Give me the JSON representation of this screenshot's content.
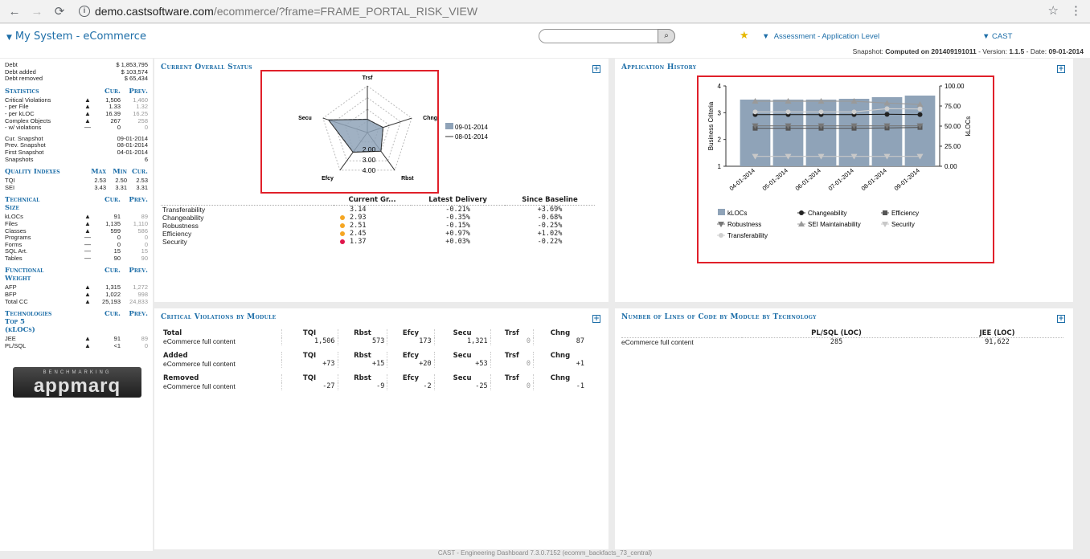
{
  "browser": {
    "url_host": "demo.castsoftware.com",
    "url_path": "/ecommerce/?frame=FRAME_PORTAL_RISK_VIEW"
  },
  "header": {
    "title": "My System - eCommerce",
    "assessment": "Assessment - Application Level",
    "user": "CAST",
    "snapshot_prefix": "Snapshot:",
    "snapshot_computed": "Computed on 201409191011",
    "version_prefix": "- Version:",
    "version": "1.1.5",
    "date_prefix": "- Date:",
    "date": "09-01-2014"
  },
  "sidebar": {
    "debt": [
      {
        "label": "Debt",
        "value": "$ 1,853,795"
      },
      {
        "label": "Debt added",
        "value": "$ 103,574"
      },
      {
        "label": "Debt removed",
        "value": "$ 65,434"
      }
    ],
    "statistics": {
      "title": "Statistics",
      "cur": "Cur.",
      "prev": "Prev.",
      "rows": [
        {
          "label": "Critical Violations",
          "ind": "▲",
          "cur": "1,506",
          "prev": "1,460"
        },
        {
          "label": "- per File",
          "ind": "▲",
          "cur": "1.33",
          "prev": "1.32"
        },
        {
          "label": "- per kLOC",
          "ind": "▲",
          "cur": "16.39",
          "prev": "16.25"
        },
        {
          "label": "Complex Objects",
          "ind": "▲",
          "cur": "267",
          "prev": "258"
        },
        {
          "label": "- w/ violations",
          "ind": "—",
          "cur": "0",
          "prev": "0"
        }
      ]
    },
    "snapshots": [
      {
        "label": "Cur. Snapshot",
        "value": "09-01-2014"
      },
      {
        "label": "Prev. Snapshot",
        "value": "08-01-2014"
      },
      {
        "label": "First Snapshot",
        "value": "04-01-2014"
      },
      {
        "label": "Snapshots",
        "value": "6"
      }
    ],
    "quality": {
      "title": "Quality Indexes",
      "max": "Max",
      "min": "Min",
      "cur": "Cur.",
      "rows": [
        {
          "label": "TQI",
          "max": "2.53",
          "min": "2.50",
          "cur": "2.53"
        },
        {
          "label": "SEI",
          "max": "3.43",
          "min": "3.31",
          "cur": "3.31"
        }
      ]
    },
    "technical": {
      "title1": "Technical",
      "title2": "Size",
      "cur": "Cur.",
      "prev": "Prev.",
      "rows": [
        {
          "label": "kLOCs",
          "ind": "▲",
          "cur": "91",
          "prev": "89"
        },
        {
          "label": "Files",
          "ind": "▲",
          "cur": "1,135",
          "prev": "1,110"
        },
        {
          "label": "Classes",
          "ind": "▲",
          "cur": "599",
          "prev": "586"
        },
        {
          "label": "Programs",
          "ind": "—",
          "cur": "0",
          "prev": "0"
        },
        {
          "label": "Forms",
          "ind": "—",
          "cur": "0",
          "prev": "0"
        },
        {
          "label": "SQL Art.",
          "ind": "—",
          "cur": "15",
          "prev": "15"
        },
        {
          "label": "Tables",
          "ind": "—",
          "cur": "90",
          "prev": "90"
        }
      ]
    },
    "functional": {
      "title1": "Functional",
      "title2": "Weight",
      "cur": "Cur.",
      "prev": "Prev.",
      "rows": [
        {
          "label": "AFP",
          "ind": "▲",
          "cur": "1,315",
          "prev": "1,272"
        },
        {
          "label": "BFP",
          "ind": "▲",
          "cur": "1,022",
          "prev": "998"
        },
        {
          "label": "Total CC",
          "ind": "▲",
          "cur": "25,193",
          "prev": "24,833"
        }
      ]
    },
    "technologies": {
      "title1": "Technologies",
      "title2": "Top 5",
      "title3": "(kLOCs)",
      "cur": "Cur.",
      "prev": "Prev.",
      "rows": [
        {
          "label": "JEE",
          "ind": "▲",
          "cur": "91",
          "prev": "89"
        },
        {
          "label": "PL/SQL",
          "ind": "▲",
          "cur": "<1",
          "prev": "0"
        }
      ]
    },
    "logo_top": "BENCHMARKING",
    "logo_main": "appmarq"
  },
  "status_panel": {
    "title": "Current Overall Status",
    "radar": {
      "axes": [
        "Trsf",
        "Chng",
        "Rbst",
        "Efcy",
        "Secu"
      ],
      "ring_labels": [
        "2.00",
        "3.00",
        "4.00"
      ],
      "legend": [
        "09-01-2014",
        "08-01-2014"
      ]
    },
    "table_headers": [
      "Current Gr...",
      "Latest Delivery",
      "Since Baseline"
    ],
    "rows": [
      {
        "name": "Transferability",
        "dot": "",
        "grade": "3.14",
        "latest": "-0.21%",
        "since": "+3.69%"
      },
      {
        "name": "Changeability",
        "dot": "#f5a623",
        "grade": "2.93",
        "latest": "-0.35%",
        "since": "-0.68%"
      },
      {
        "name": "Robustness",
        "dot": "#f5a623",
        "grade": "2.51",
        "latest": "-0.15%",
        "since": "-0.25%"
      },
      {
        "name": "Efficiency",
        "dot": "#f5a623",
        "grade": "2.45",
        "latest": "+0.97%",
        "since": "+1.02%"
      },
      {
        "name": "Security",
        "dot": "#e0154b",
        "grade": "1.37",
        "latest": "+0.03%",
        "since": "-0.22%"
      }
    ]
  },
  "history_panel": {
    "title": "Application History",
    "left_axis_label": "Business Criteria",
    "right_axis_label": "kLOCs",
    "left_ticks": [
      "1",
      "2",
      "3",
      "4"
    ],
    "right_ticks": [
      "0.00",
      "25.00",
      "50.00",
      "75.00",
      "100.00"
    ],
    "legend": [
      "kLOCs",
      "Changeability",
      "Efficiency",
      "Robustness",
      "SEI Maintainability",
      "Security",
      "Transferability"
    ]
  },
  "chart_data": {
    "type": "bar",
    "title": "Application History",
    "categories": [
      "04-01-2014",
      "05-01-2014",
      "06-01-2014",
      "07-01-2014",
      "08-01-2014",
      "09-01-2014"
    ],
    "ylabel": "Business Criteria",
    "y2label": "kLOCs",
    "ylim": [
      1,
      4
    ],
    "y2lim": [
      0,
      100
    ],
    "series": [
      {
        "name": "kLOCs",
        "axis": "right",
        "kind": "bar",
        "values": [
          83,
          83,
          83,
          84,
          86,
          88
        ]
      },
      {
        "name": "Changeability",
        "axis": "left",
        "kind": "line",
        "values": [
          2.93,
          2.93,
          2.93,
          2.93,
          2.94,
          2.93
        ]
      },
      {
        "name": "Efficiency",
        "axis": "left",
        "kind": "line",
        "values": [
          2.42,
          2.42,
          2.42,
          2.42,
          2.43,
          2.45
        ]
      },
      {
        "name": "Robustness",
        "axis": "left",
        "kind": "line",
        "values": [
          2.51,
          2.51,
          2.51,
          2.51,
          2.51,
          2.51
        ]
      },
      {
        "name": "SEI Maintainability",
        "axis": "left",
        "kind": "line",
        "values": [
          3.43,
          3.43,
          3.43,
          3.43,
          3.36,
          3.31
        ]
      },
      {
        "name": "Security",
        "axis": "left",
        "kind": "line",
        "values": [
          1.37,
          1.37,
          1.37,
          1.37,
          1.37,
          1.37
        ]
      },
      {
        "name": "Transferability",
        "axis": "left",
        "kind": "line",
        "values": [
          3.03,
          3.03,
          3.03,
          3.03,
          3.15,
          3.14
        ]
      }
    ]
  },
  "violations_panel": {
    "title": "Critical Violations by Module",
    "columns": [
      "TQI",
      "Rbst",
      "Efcy",
      "Secu",
      "Trsf",
      "Chng"
    ],
    "groups": [
      {
        "title": "Total",
        "row": "eCommerce full content",
        "values": [
          "1,506",
          "573",
          "173",
          "1,321",
          "0",
          "87"
        ]
      },
      {
        "title": "Added",
        "row": "eCommerce full content",
        "values": [
          "+73",
          "+15",
          "+20",
          "+53",
          "0",
          "+1"
        ]
      },
      {
        "title": "Removed",
        "row": "eCommerce full content",
        "values": [
          "-27",
          "-9",
          "-2",
          "-25",
          "0",
          "-1"
        ]
      }
    ]
  },
  "loc_panel": {
    "title": "Number of Lines of Code by Module by Technology",
    "columns": [
      "PL/SQL (LOC)",
      "JEE (LOC)"
    ],
    "rows": [
      {
        "name": "eCommerce full content",
        "values": [
          "285",
          "91,622"
        ]
      }
    ]
  },
  "footer": "CAST - Engineering Dashboard 7.3.0.7152 (ecomm_backfacts_73_central)",
  "colors": {
    "accent": "#1d6ea8",
    "highlight": "#e0202a",
    "bar": "#8fa3b8"
  }
}
